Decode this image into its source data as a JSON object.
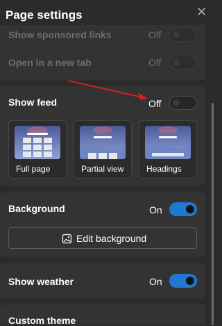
{
  "header": {
    "title": "Page settings"
  },
  "sponsored": {
    "label": "Show sponsored links",
    "state": "Off"
  },
  "new_tab": {
    "label": "Open in a new tab",
    "state": "Off"
  },
  "feed": {
    "label": "Show feed",
    "state": "Off",
    "layouts": [
      {
        "label": "Full page"
      },
      {
        "label": "Partial view"
      },
      {
        "label": "Headings"
      }
    ]
  },
  "background": {
    "label": "Background",
    "state": "On",
    "button_label": "Edit background"
  },
  "weather": {
    "label": "Show weather",
    "state": "On"
  },
  "theme": {
    "label": "Custom theme"
  },
  "colors": {
    "accent": "#1f78d1",
    "annotation_arrow": "#d61f1f",
    "panel": "#333333",
    "page": "#2b2b2b"
  },
  "icons": {
    "close": "close-icon",
    "image": "image-icon"
  }
}
